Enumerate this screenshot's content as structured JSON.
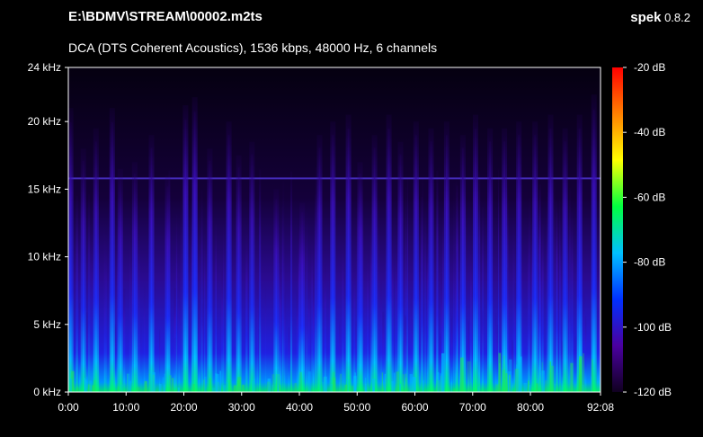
{
  "header": {
    "file_path": "E:\\BDMV\\STREAM\\00002.m2ts",
    "stream_info": "DCA (DTS Coherent Acoustics), 1536 kbps, 48000 Hz, 6 channels",
    "app_name": "spek",
    "app_version": "0.8.2"
  },
  "chart_data": {
    "type": "heatmap",
    "title": "E:\\BDMV\\STREAM\\00002.m2ts",
    "subtitle": "DCA (DTS Coherent Acoustics), 1536 kbps, 48000 Hz, 6 channels",
    "x_ticks": [
      "0:00",
      "10:00",
      "20:00",
      "30:00",
      "40:00",
      "50:00",
      "60:00",
      "70:00",
      "80:00",
      "92:08"
    ],
    "x_range_seconds": [
      0,
      5528
    ],
    "y_ticks": [
      "0 kHz",
      "5 kHz",
      "10 kHz",
      "15 kHz",
      "20 kHz",
      "24 kHz"
    ],
    "y_range_khz": [
      0,
      24
    ],
    "colorbar_ticks": [
      "-20 dB",
      "-40 dB",
      "-60 dB",
      "-80 dB",
      "-100 dB",
      "-120 dB"
    ],
    "colorbar_range_db": [
      -120,
      -20
    ],
    "colorbar_colors": [
      "#ff0000",
      "#ff8000",
      "#ffff00",
      "#00ff40",
      "#00c0ff",
      "#0030ff",
      "#4a00a0",
      "#100020"
    ],
    "constant_tone_khz": 15.8,
    "peaks": [
      {
        "t": 0.4,
        "khz": 21.0,
        "i": 0.55
      },
      {
        "t": 2.6,
        "khz": 18.0,
        "i": 0.45
      },
      {
        "t": 4.8,
        "khz": 19.5,
        "i": 0.5
      },
      {
        "t": 7.6,
        "khz": 21.0,
        "i": 0.75
      },
      {
        "t": 9.0,
        "khz": 16.5,
        "i": 0.5
      },
      {
        "t": 11.5,
        "khz": 17.0,
        "i": 0.55
      },
      {
        "t": 14.4,
        "khz": 19.0,
        "i": 0.7
      },
      {
        "t": 17.2,
        "khz": 16.0,
        "i": 0.6
      },
      {
        "t": 20.3,
        "khz": 21.2,
        "i": 0.95
      },
      {
        "t": 21.9,
        "khz": 21.8,
        "i": 0.9
      },
      {
        "t": 24.5,
        "khz": 18.0,
        "i": 0.6
      },
      {
        "t": 27.8,
        "khz": 20.0,
        "i": 0.8
      },
      {
        "t": 29.5,
        "khz": 17.5,
        "i": 0.55
      },
      {
        "t": 31.8,
        "khz": 18.5,
        "i": 0.5
      },
      {
        "t": 36.0,
        "khz": 15.0,
        "i": 0.5
      },
      {
        "t": 40.5,
        "khz": 14.0,
        "i": 0.65
      },
      {
        "t": 43.5,
        "khz": 19.0,
        "i": 0.6
      },
      {
        "t": 45.8,
        "khz": 20.0,
        "i": 0.75
      },
      {
        "t": 48.5,
        "khz": 20.5,
        "i": 0.8
      },
      {
        "t": 50.5,
        "khz": 17.0,
        "i": 0.65
      },
      {
        "t": 53.0,
        "khz": 19.0,
        "i": 0.7
      },
      {
        "t": 55.5,
        "khz": 20.5,
        "i": 0.75
      },
      {
        "t": 57.5,
        "khz": 18.5,
        "i": 0.6
      },
      {
        "t": 60.2,
        "khz": 20.0,
        "i": 0.7
      },
      {
        "t": 62.8,
        "khz": 19.5,
        "i": 0.7
      },
      {
        "t": 65.5,
        "khz": 20.0,
        "i": 0.65
      },
      {
        "t": 68.3,
        "khz": 19.0,
        "i": 0.7
      },
      {
        "t": 70.5,
        "khz": 20.5,
        "i": 0.8
      },
      {
        "t": 73.0,
        "khz": 19.5,
        "i": 0.75
      },
      {
        "t": 75.5,
        "khz": 19.5,
        "i": 0.8
      },
      {
        "t": 78.0,
        "khz": 20.0,
        "i": 0.75
      },
      {
        "t": 80.8,
        "khz": 20.0,
        "i": 0.75
      },
      {
        "t": 83.5,
        "khz": 20.5,
        "i": 0.75
      },
      {
        "t": 86.0,
        "khz": 19.5,
        "i": 0.7
      },
      {
        "t": 88.5,
        "khz": 20.5,
        "i": 0.75
      },
      {
        "t": 91.0,
        "khz": 22.0,
        "i": 0.85
      }
    ]
  }
}
